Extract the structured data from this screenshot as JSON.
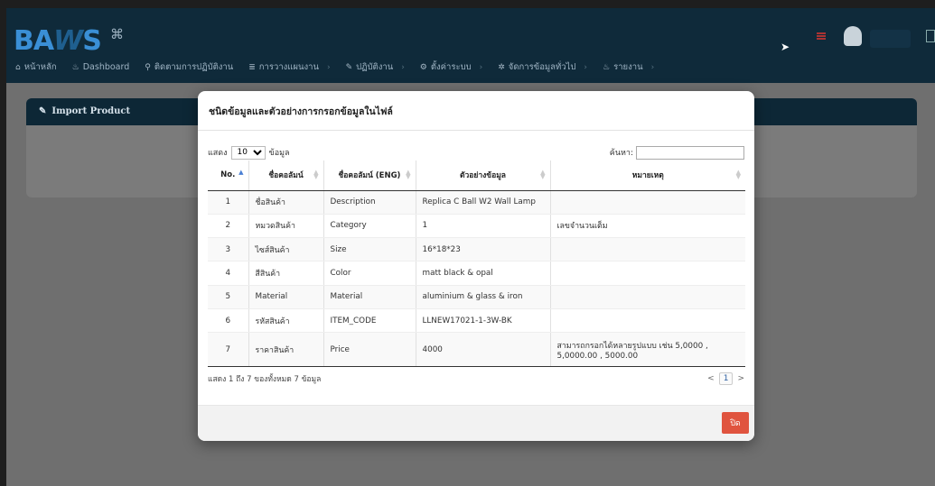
{
  "app": {
    "logo": {
      "part1": "BA",
      "part2": "W",
      "part3": "S"
    },
    "nav": [
      {
        "icon": "home-icon",
        "glyph": "⌂",
        "label": "หน้าหลัก"
      },
      {
        "icon": "dashboard-icon",
        "glyph": "♨",
        "label": "Dashboard"
      },
      {
        "icon": "map-pin-icon",
        "glyph": "⚲",
        "label": "ติดตามการปฏิบัติงาน"
      },
      {
        "icon": "list-icon",
        "glyph": "≣",
        "label": "การวางแผนงาน"
      },
      {
        "icon": "edit-icon",
        "glyph": "✎",
        "label": "ปฏิบัติงาน"
      },
      {
        "icon": "gears-icon",
        "glyph": "⚙",
        "label": "ตั้งค่าระบบ"
      },
      {
        "icon": "gear-icon",
        "glyph": "✲",
        "label": "จัดการข้อมูลทั่วไป"
      },
      {
        "icon": "report-icon",
        "glyph": "♨",
        "label": "รายงาน"
      }
    ]
  },
  "panel": {
    "title": "Import Product"
  },
  "modal": {
    "title": "ชนิดข้อมูลและตัวอย่างการกรอกข้อมูลในไฟล์",
    "length": {
      "prefix": "แสดง",
      "value": "10",
      "suffix": "ข้อมูล"
    },
    "search": {
      "label": "ค้นหา:",
      "value": ""
    },
    "columns": [
      "No.",
      "ชื่อคอลัมน์",
      "ชื่อคอลัมน์ (ENG)",
      "ตัวอย่างข้อมูล",
      "หมายเหตุ"
    ],
    "rows": [
      {
        "no": "1",
        "col_th": "ชื่อสินค้า",
        "col_en": "Description",
        "example": "Replica C Ball W2 Wall Lamp",
        "note": ""
      },
      {
        "no": "2",
        "col_th": "หมวดสินค้า",
        "col_en": "Category",
        "example": "1",
        "note": "เลขจำนวนเต็ม"
      },
      {
        "no": "3",
        "col_th": "ไซส์สินค้า",
        "col_en": "Size",
        "example": "16*18*23",
        "note": ""
      },
      {
        "no": "4",
        "col_th": "สีสินค้า",
        "col_en": "Color",
        "example": "matt black & opal",
        "note": ""
      },
      {
        "no": "5",
        "col_th": "Material",
        "col_en": "Material",
        "example": "aluminium & glass & iron",
        "note": ""
      },
      {
        "no": "6",
        "col_th": "รหัสสินค้า",
        "col_en": "ITEM_CODE",
        "example": "LLNEW17021-1-3W-BK",
        "note": ""
      },
      {
        "no": "7",
        "col_th": "ราคาสินค้า",
        "col_en": "Price",
        "example": "4000",
        "note": "สามารถกรอกได้หลายรูปแบบ เช่น 5,0000 , 5,0000.00 , 5000.00"
      }
    ],
    "info": "แสดง 1 ถึง 7 ของทั้งหมด 7 ข้อมูล",
    "pager": {
      "prev": "<",
      "current": "1",
      "next": ">"
    },
    "close_label": "ปิด"
  }
}
